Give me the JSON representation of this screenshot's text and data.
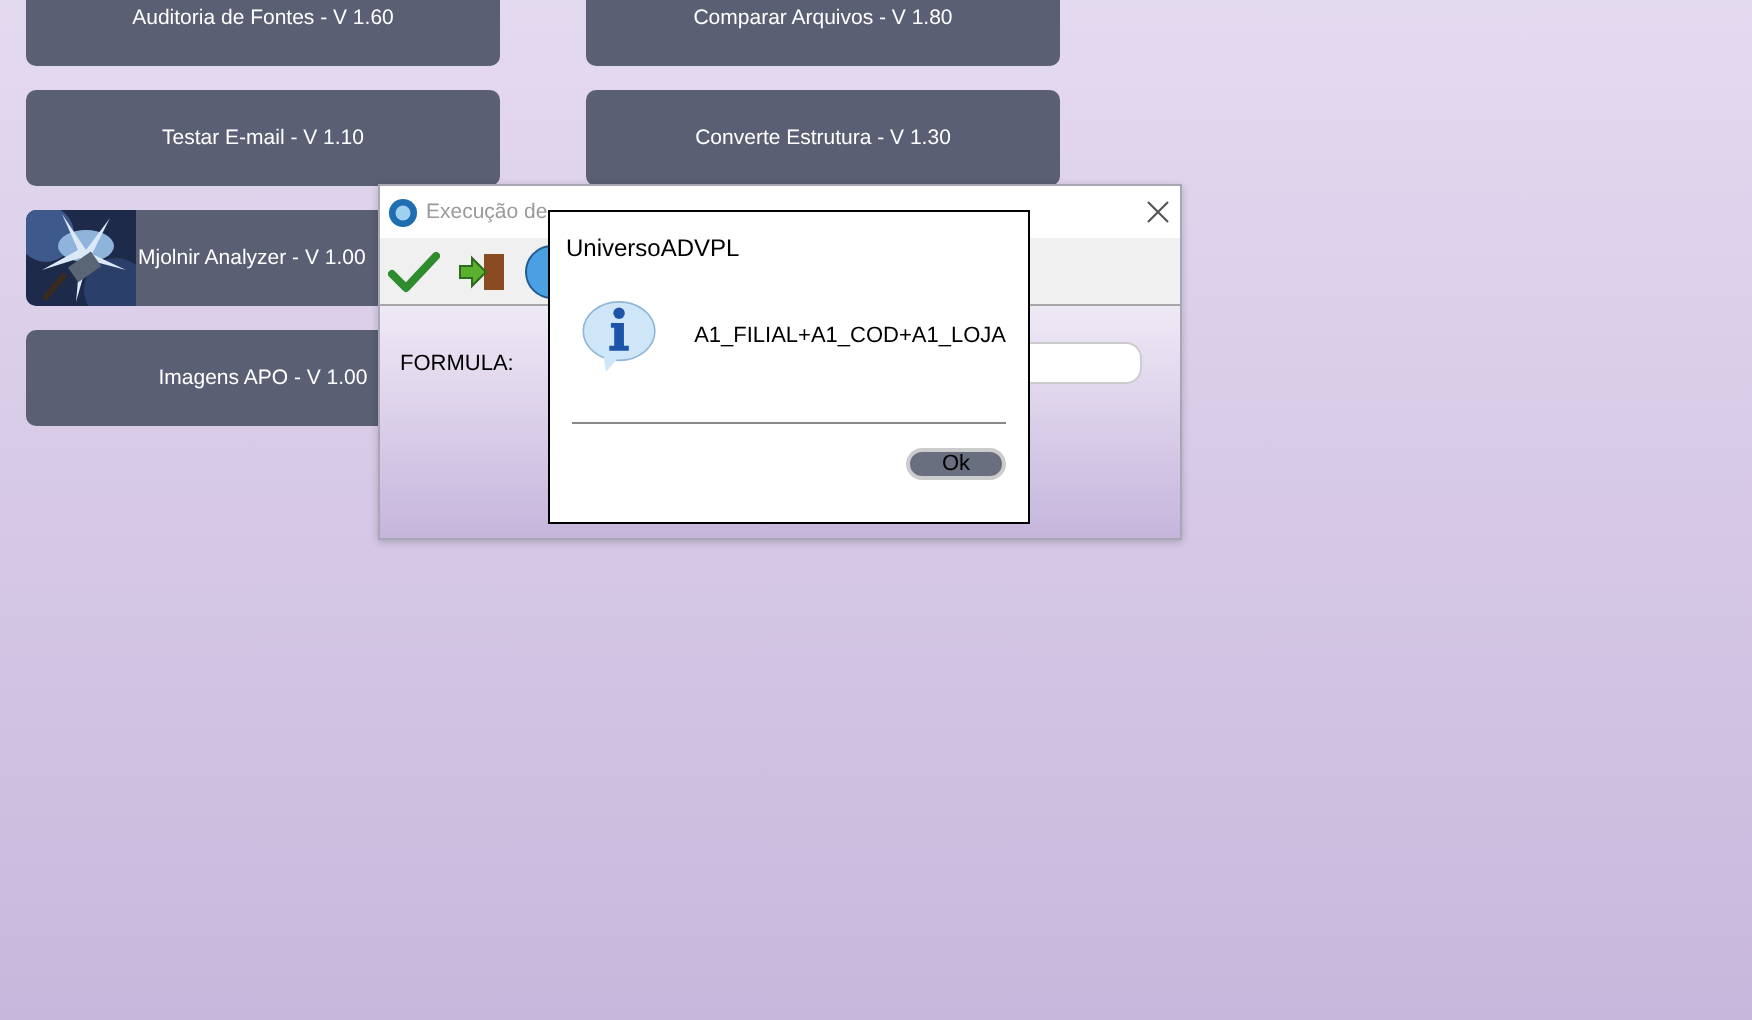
{
  "launcher_buttons": [
    {
      "label": "Auditoria de Fontes - V 1.60",
      "kind": "text"
    },
    {
      "label": "Testar E-mail - V 1.10",
      "kind": "text"
    },
    {
      "label": "Mjolnir Analyzer - V 1.00",
      "kind": "picture"
    },
    {
      "label": "Imagens APO - V 1.00",
      "kind": "text"
    },
    {
      "label": "Comparar Arquivos - V 1.80",
      "kind": "text"
    },
    {
      "label": "Converte Estrutura - V 1.30",
      "kind": "text"
    }
  ],
  "window": {
    "title": "Execução de",
    "form_label": "FORMULA:"
  },
  "message_box": {
    "title": "UniversoADVPL",
    "message": "A1_FILIAL+A1_COD+A1_LOJA",
    "button": "Ok"
  }
}
